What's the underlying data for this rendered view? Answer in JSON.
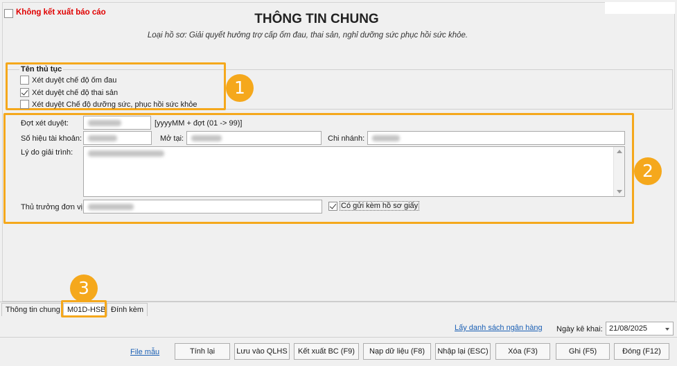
{
  "header": {
    "no_export_label": "Không kết xuất báo cáo",
    "title": "THÔNG TIN CHUNG",
    "subtitle": "Loại hồ sơ: Giải quyết  hưởng trợ cấp ốm đau, thai sản, nghỉ dưỡng sức phục hồi sức khỏe."
  },
  "procedure": {
    "group_title": "Tên thủ tục",
    "items": [
      {
        "label": "Xét duyệt chế độ ốm đau",
        "checked": false
      },
      {
        "label": "Xét duyệt chế độ thai sản",
        "checked": true
      },
      {
        "label": "Xét duyệt Chế độ dưỡng sức, phục hồi sức khỏe",
        "checked": false
      }
    ]
  },
  "form": {
    "batch_label": "Đợt xét duyệt:",
    "batch_hint": "[yyyyMM + đợt (01 -> 99)]",
    "account_label": "Số hiệu tài khoản:",
    "opened_at_label": "Mở tại:",
    "branch_label": "Chi nhánh:",
    "reason_label": "Lý do giải trình:",
    "head_label": "Thủ trưởng đơn vị:",
    "paper_label": "Có gửi kèm hồ sơ giấy",
    "paper_checked": true
  },
  "badges": [
    "1",
    "2",
    "3"
  ],
  "tabs": [
    {
      "label": "Thông tin chung",
      "active": false
    },
    {
      "label": "M01D-HSB",
      "active": true
    },
    {
      "label": "Đính kèm",
      "active": false
    }
  ],
  "footer": {
    "bank_list_link": "Lấy danh sách ngân hàng",
    "date_label": "Ngày kê khai:",
    "date_value": "21/08/2025",
    "sample_file_link": "File mẫu",
    "buttons": [
      "Tính lại",
      "Lưu vào QLHS",
      "Kết xuất BC (F9)",
      "Nạp dữ liệu (F8)",
      "Nhập lại (ESC)",
      "Xóa (F3)",
      "Ghi (F5)",
      "Đóng (F12)"
    ]
  },
  "colors": {
    "accent": "#f5a81c",
    "warning_text": "#e00000",
    "link": "#1a5fb4"
  }
}
